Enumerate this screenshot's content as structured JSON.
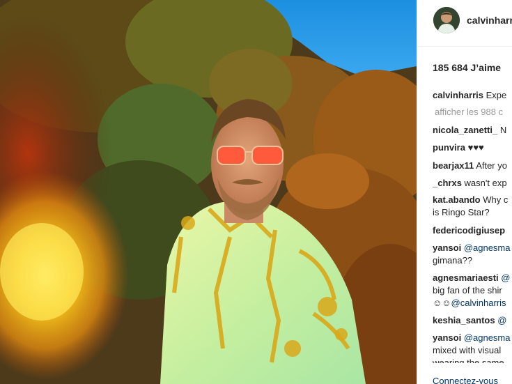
{
  "post": {
    "username": "calvinharris",
    "likes": "185 684 J’aime",
    "caption": {
      "user": "calvinharris",
      "text": "Expe"
    },
    "view_all": "afficher les 988 c",
    "comments": [
      {
        "user": "nicola_zanetti_",
        "text": "N"
      },
      {
        "user": "punvira",
        "text": "♥♥♥"
      },
      {
        "user": "bearjax11",
        "text": "After yo"
      },
      {
        "user": "_chrxs",
        "text": "wasn't exp"
      },
      {
        "user": "kat.abando",
        "text": "Why c",
        "line2": "is Ringo Star?"
      },
      {
        "user": "federicodigiusep",
        "text": ""
      },
      {
        "user": "yansoi",
        "mention": "@agnesma",
        "line2": "gimana??"
      },
      {
        "user": "agnesmariaesti",
        "mention": "@",
        "line2": "big fan of the shir",
        "line3_emoji": "☺☺",
        "line3_mention": "@calvinharris"
      },
      {
        "user": "keshia_santos",
        "mention": "@"
      },
      {
        "user": "yansoi",
        "mention": "@agnesma",
        "line2": "mixed with visual",
        "line3": "wearing the same"
      }
    ],
    "login_link": "Connectez-vous"
  },
  "colors": {
    "username": "#262626",
    "link": "#003569",
    "muted": "#999999",
    "border": "#efefef"
  }
}
